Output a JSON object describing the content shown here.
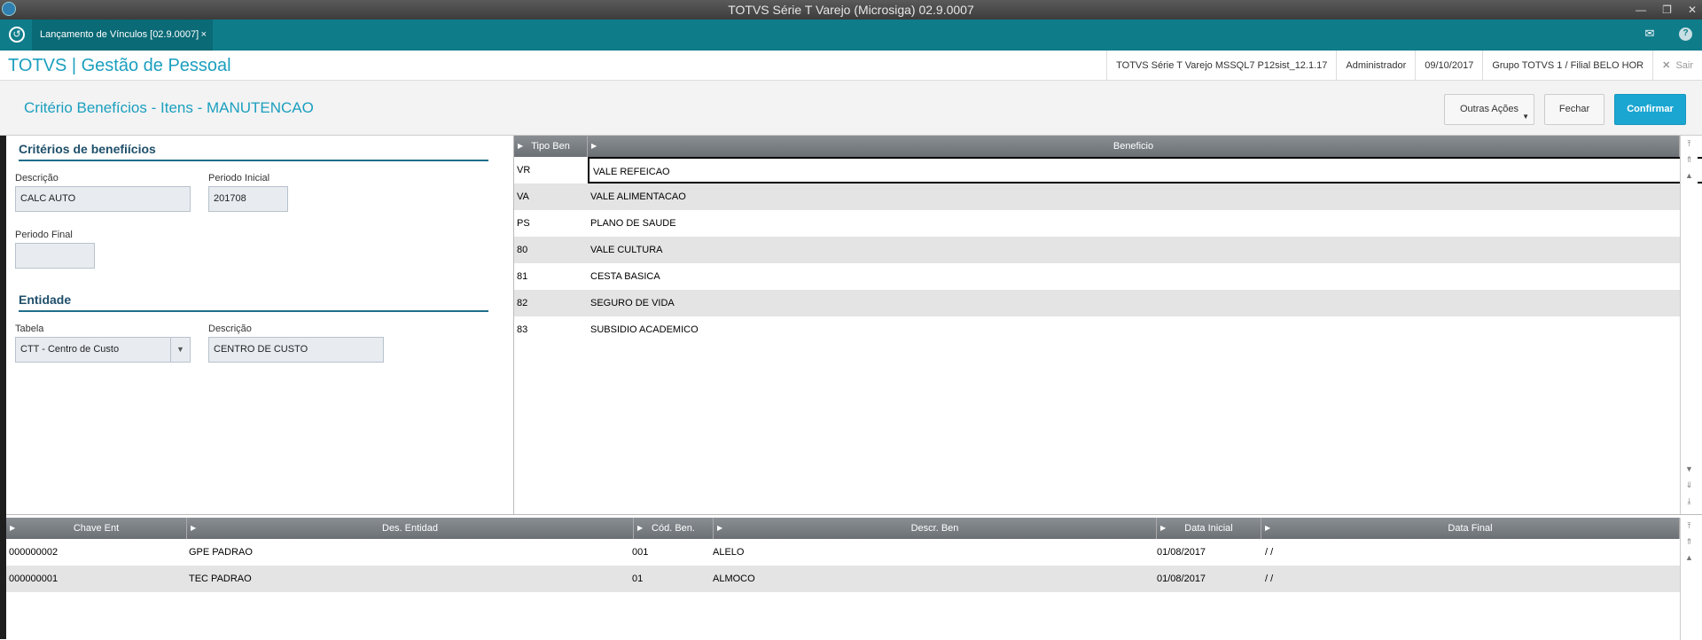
{
  "window": {
    "title": "TOTVS Série T Varejo (Microsiga) 02.9.0007"
  },
  "tabs": [
    {
      "label": "Lançamento de Vínculos [02.9.0007]"
    }
  ],
  "app": {
    "title": "TOTVS | Gestão de Pessoal",
    "env": "TOTVS Série T Varejo MSSQL7 P12sist_12.1.17",
    "user": "Administrador",
    "date": "09/10/2017",
    "group": "Grupo TOTVS 1 / Filial BELO HOR",
    "exit": "Sair"
  },
  "page": {
    "title": "Critério Benefícios - Itens - MANUTENCAO"
  },
  "buttons": {
    "more": "Outras Ações",
    "close": "Fechar",
    "confirm": "Confirmar"
  },
  "form": {
    "section1": "Critérios de benefiícios",
    "descricao_label": "Descrição",
    "descricao_value": "CALC AUTO",
    "periodo_inicial_label": "Periodo Inicial",
    "periodo_inicial_value": "201708",
    "periodo_final_label": "Periodo Final",
    "periodo_final_value": "",
    "section2": "Entidade",
    "tabela_label": "Tabela",
    "tabela_value": "CTT - Centro de Custo",
    "descricao2_label": "Descrição",
    "descricao2_value": "CENTRO DE CUSTO"
  },
  "benefits_grid": {
    "headers": [
      "Tipo Ben",
      "Beneficio"
    ],
    "rows": [
      [
        "VR",
        "VALE REFEICAO"
      ],
      [
        "VA",
        "VALE ALIMENTACAO"
      ],
      [
        "PS",
        "PLANO DE SAUDE"
      ],
      [
        "80",
        "VALE CULTURA"
      ],
      [
        "81",
        "CESTA BASICA"
      ],
      [
        "82",
        "SEGURO DE VIDA"
      ],
      [
        "83",
        "SUBSIDIO ACADEMICO"
      ]
    ]
  },
  "entity_grid": {
    "headers": [
      "Chave Ent",
      "Des. Entidad",
      "Cód. Ben.",
      "Descr. Ben",
      "Data Inicial",
      "Data Final"
    ],
    "rows": [
      [
        "000000002",
        "GPE PADRAO",
        "001",
        "ALELO",
        "01/08/2017",
        "/  /"
      ],
      [
        "000000001",
        "TEC PADRAO",
        "01",
        "ALMOCO",
        "01/08/2017",
        "/  /"
      ]
    ]
  }
}
